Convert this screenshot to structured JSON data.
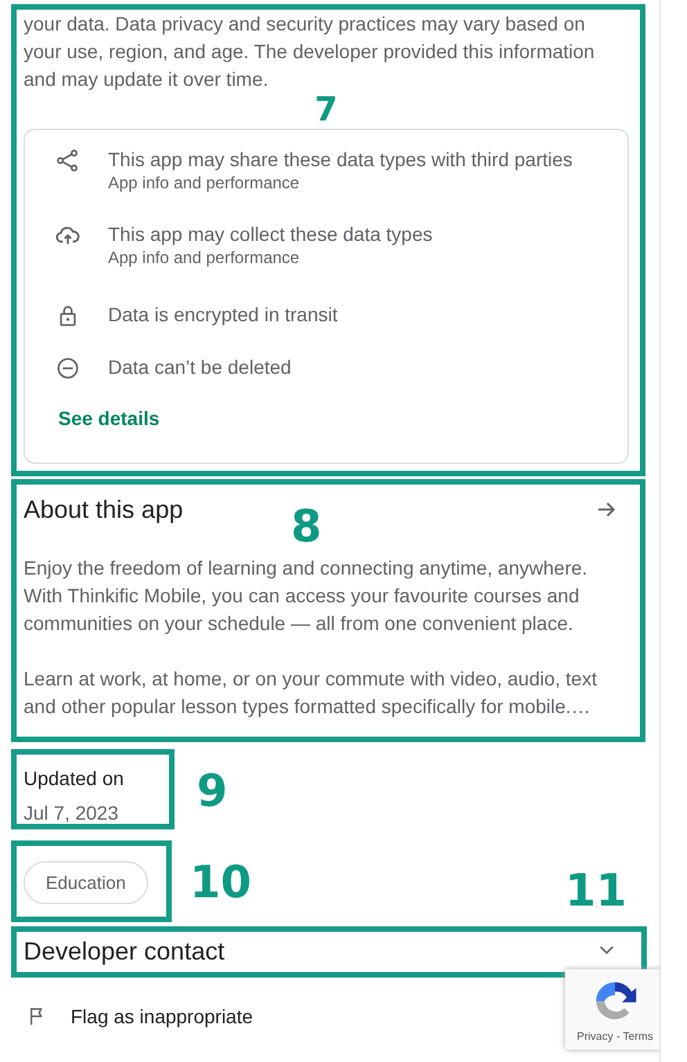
{
  "safety_section": {
    "annotation": "7",
    "intro": "your data. Data privacy and security practices may vary based on your use, region, and age. The developer provided this information and may update it over time.",
    "items": [
      {
        "kind": "share",
        "title": "This app may share these data types with third parties",
        "subtitle": "App info and performance"
      },
      {
        "kind": "collect",
        "title": "This app may collect these data types",
        "subtitle": "App info and performance"
      },
      {
        "kind": "lock",
        "title": "Data is encrypted in transit"
      },
      {
        "kind": "delete",
        "title": "Data can’t be deleted"
      }
    ],
    "link": "See details"
  },
  "about_section": {
    "annotation": "8",
    "title": "About this app",
    "paragraphs": [
      "Enjoy the freedom of learning and connecting anytime, anywhere. With Thinkific Mobile, you can access your favourite courses and communities on your schedule — all from one convenient place.",
      "Learn at work, at home, or on your commute with video, audio, text and other popular lesson types formatted specifically for mobile.…"
    ]
  },
  "updated_section": {
    "annotation": "9",
    "label": "Updated on",
    "date": "Jul 7, 2023"
  },
  "category_section": {
    "annotation": "10",
    "chip": "Education"
  },
  "developer_section": {
    "annotation": "11",
    "title": "Developer contact",
    "expanded": false
  },
  "flag": {
    "label": "Flag as inappropriate"
  },
  "recaptcha": {
    "links": "Privacy - Terms"
  }
}
